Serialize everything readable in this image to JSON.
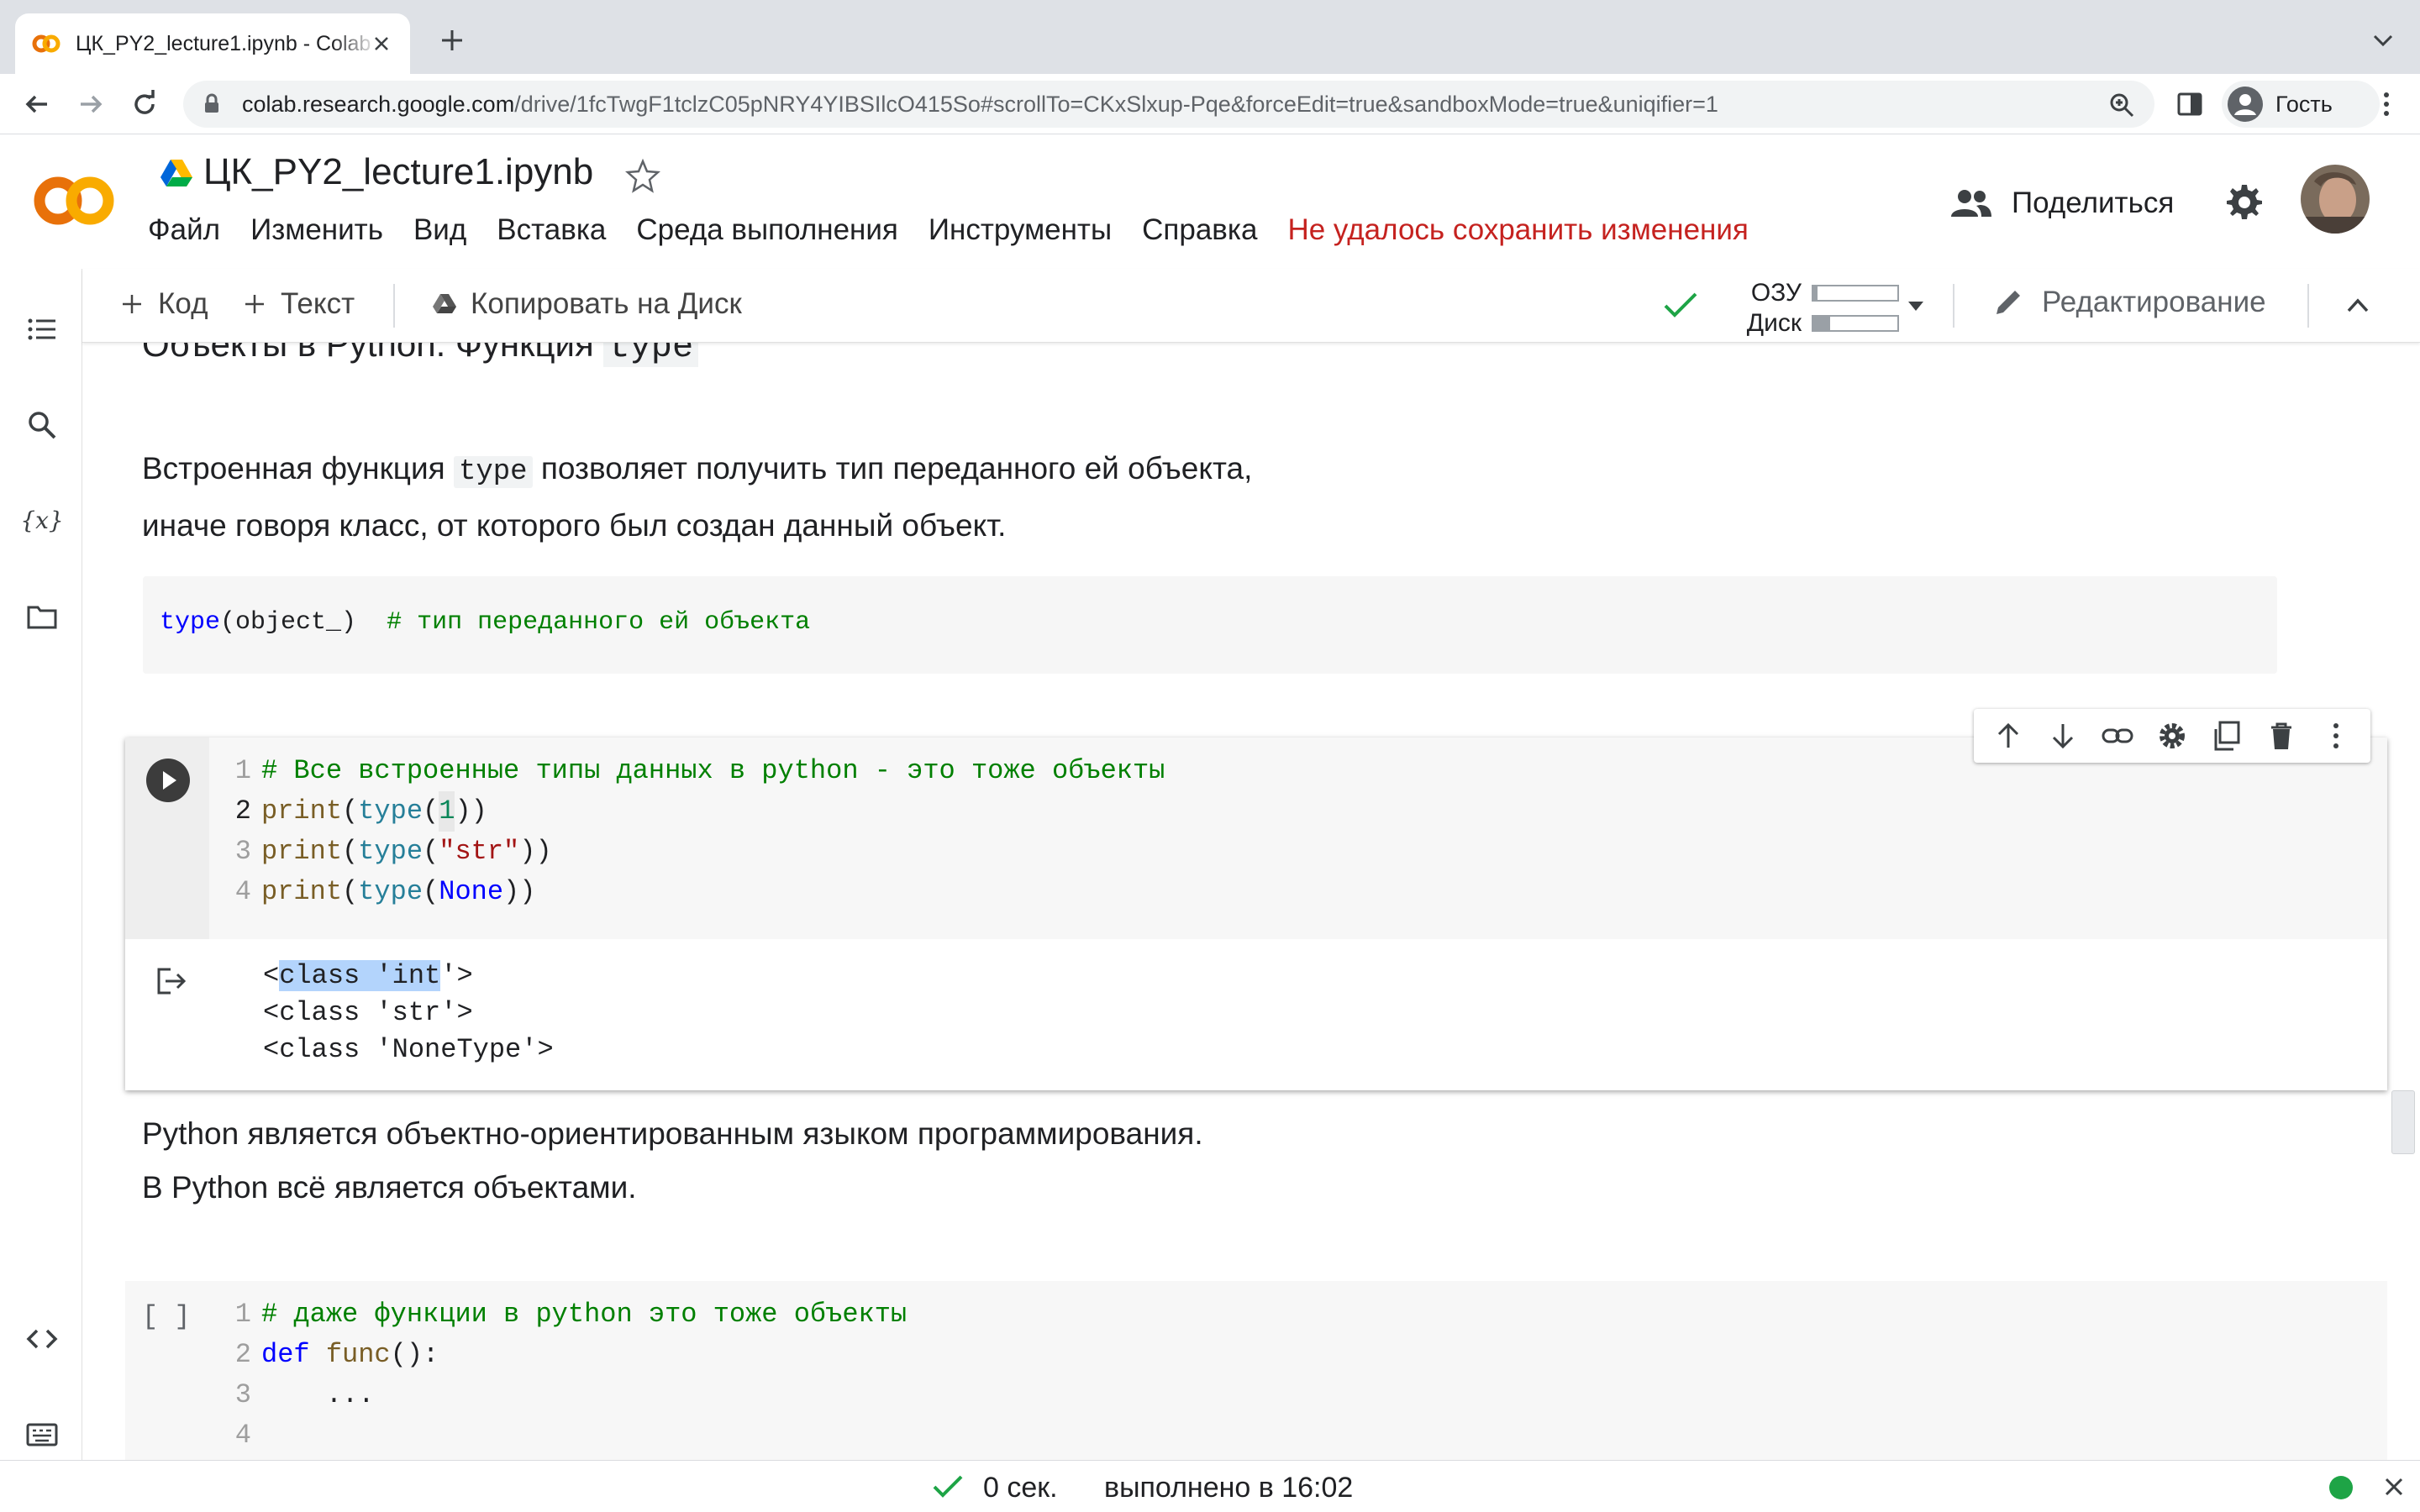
{
  "browser": {
    "tab_title": "ЦК_PY2_lecture1.ipynb - Colab",
    "url_host": "colab.research.google.com",
    "url_path": "/drive/1fcTwgF1tclzC05pNRY4YIBSIlcO415So#scrollTo=CKxSlxup-Pqe&forceEdit=true&sandboxMode=true&uniqifier=1",
    "profile_label": "Гость"
  },
  "colab": {
    "logo_text": "CO",
    "notebook_title": "ЦК_PY2_lecture1.ipynb",
    "menu": [
      "Файл",
      "Изменить",
      "Вид",
      "Вставка",
      "Среда выполнения",
      "Инструменты",
      "Справка"
    ],
    "save_error": "Не удалось сохранить изменения",
    "share_label": "Поделиться"
  },
  "toolbar": {
    "add_code": "Код",
    "add_text": "Текст",
    "copy_to_drive": "Копировать на Диск",
    "ram_label": "ОЗУ",
    "disk_label": "Диск",
    "ram_usage": 0.05,
    "disk_usage": 0.2,
    "edit_mode": "Редактирование"
  },
  "content": {
    "heading_partial_text": "Объекты в Python. Функция ",
    "heading_partial_code": "type",
    "para1_before": "Встроенная функция ",
    "para1_code": "type",
    "para1_after": " позволяет получить тип переданного ей объекта,",
    "para1_line2": "иначе говоря класс, от которого был создан данный объект.",
    "md_code_fn": "type",
    "md_code_args": "(object_)",
    "md_code_comment": "# тип переданного ей объекта",
    "cell1": {
      "line_numbers": [
        "1",
        "2",
        "3",
        "4"
      ],
      "code": {
        "l1_comment": "# Все встроенные типы данных в python - это тоже объекты",
        "print": "print",
        "type": "type",
        "num": "1",
        "str": "\"str\"",
        "none": "None",
        "open_paren": "(",
        "close2": "))"
      },
      "output": [
        "<class 'int'>",
        "<class 'str'>",
        "<class 'NoneType'>"
      ],
      "output_first_prefix": "<",
      "output_first_selected": "class 'int",
      "output_first_suffix": "'>"
    },
    "para2_line1": "Python является объектно-ориентированным языком программирования.",
    "para2_line2": "В Python всё является объектами.",
    "cell2": {
      "exec_count": "[ ]",
      "line_numbers": [
        "1",
        "2",
        "3",
        "4"
      ],
      "l1_comment": "# даже функции в python это тоже объекты",
      "def_kw": "def",
      "fn_name": "func",
      "fn_rest": "():",
      "l3": "    ...",
      "l4": ""
    }
  },
  "status": {
    "duration": "0 сек.",
    "executed_at": "выполнено в 16:02"
  },
  "colors": {
    "colab_orange": "#f9ab00",
    "error_red": "#c5221f",
    "ok_green": "#1ea446"
  }
}
